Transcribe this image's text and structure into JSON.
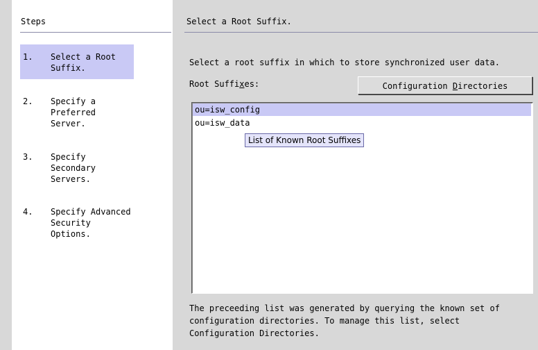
{
  "steps": {
    "title": "Steps",
    "items": [
      {
        "number": "1.",
        "label": "Select a Root\nSuffix.",
        "selected": true
      },
      {
        "number": "2.",
        "label": "Specify a\nPreferred\nServer.",
        "selected": false
      },
      {
        "number": "3.",
        "label": "Specify\nSecondary\nServers.",
        "selected": false
      },
      {
        "number": "4.",
        "label": "Specify Advanced\nSecurity\nOptions.",
        "selected": false
      }
    ]
  },
  "main": {
    "title": "Select a Root Suffix.",
    "instructions": "Select a root suffix in which to store synchronized user data.",
    "root_label_pre": "Root Suffi",
    "root_label_mnemonic": "x",
    "root_label_post": "es:",
    "config_button_pre": "Configuration ",
    "config_button_mnemonic": "D",
    "config_button_post": "irectories",
    "list_items": [
      {
        "value": "ou=isw_config",
        "selected": true
      },
      {
        "value": "ou=isw_data",
        "selected": false
      }
    ],
    "tooltip": "List of Known Root Suffixes",
    "footer": "The preceeding list was generated by querying the known set of\nconfiguration directories. To manage this list, select\nConfiguration Directories."
  },
  "colors": {
    "selection": "#c9c9f5",
    "background": "#d8d8d8",
    "panel": "#ffffff"
  }
}
